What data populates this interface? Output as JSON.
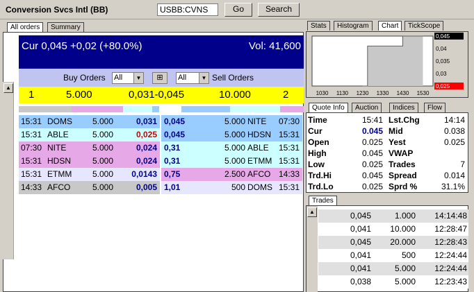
{
  "header": {
    "title": "Conversion Svcs Intl (BB)",
    "symbol": "USBB:CVNS",
    "go_label": "Go",
    "search_label": "Search"
  },
  "left_tabs": [
    "All orders",
    "Summary"
  ],
  "quote_bar": {
    "cur": "Cur 0,045 +0,02 (+80.0%)",
    "vol": "Vol: 41,600"
  },
  "orders_header": {
    "buy_label": "Buy Orders",
    "sell_label": "Sell Orders",
    "buy_filter": "All",
    "sell_filter": "All"
  },
  "best": {
    "bid_count": "1",
    "bid_size": "5.000",
    "spread": "0,031-0,045",
    "ask_size": "10.000",
    "ask_count": "2"
  },
  "colors": {
    "navy": "#00008b",
    "yellow": "#ffff00",
    "blue_row": "#99ccff",
    "cyan_row": "#ccffff",
    "pink_row": "#e6a8e6",
    "lavender_row": "#e6e6ff",
    "grey_row": "#c8c8c8",
    "red_price": "#cc0000"
  },
  "buy_orders": [
    {
      "time": "15:31",
      "mm": "DOMS",
      "size": "5.000",
      "price": "0,031",
      "color": "#99ccff",
      "price_color": "#00008b"
    },
    {
      "time": "15:31",
      "mm": "ABLE",
      "size": "5.000",
      "price": "0,025",
      "color": "#ccffff",
      "price_color": "#cc0000"
    },
    {
      "time": "07:30",
      "mm": "NITE",
      "size": "5.000",
      "price": "0,024",
      "color": "#e6a8e6",
      "price_color": "#00008b"
    },
    {
      "time": "15:31",
      "mm": "HDSN",
      "size": "5.000",
      "price": "0,024",
      "color": "#e6a8e6",
      "price_color": "#00008b"
    },
    {
      "time": "15:31",
      "mm": "ETMM",
      "size": "5.000",
      "price": "0,0143",
      "color": "#e6e6ff",
      "price_color": "#00008b"
    },
    {
      "time": "14:33",
      "mm": "AFCO",
      "size": "5.000",
      "price": "0,005",
      "color": "#c8c8c8",
      "price_color": "#00008b"
    }
  ],
  "sell_orders": [
    {
      "price": "0,045",
      "size": "5.000",
      "mm": "NITE",
      "time": "07:30",
      "color": "#99ccff"
    },
    {
      "price": "0,045",
      "size": "5.000",
      "mm": "HDSN",
      "time": "15:31",
      "color": "#99ccff"
    },
    {
      "price": "0,31",
      "size": "5.000",
      "mm": "ABLE",
      "time": "15:31",
      "color": "#ccffff"
    },
    {
      "price": "0,31",
      "size": "5.000",
      "mm": "ETMM",
      "time": "15:31",
      "color": "#ccffff"
    },
    {
      "price": "0,75",
      "size": "2.500",
      "mm": "AFCO",
      "time": "14:33",
      "color": "#e6a8e6"
    },
    {
      "price": "1,01",
      "size": "500",
      "mm": "DOMS",
      "time": "15:31",
      "color": "#e6e6ff"
    }
  ],
  "right_tabs_top": [
    "Stats",
    "Histogram",
    "Chart",
    "TickScope"
  ],
  "chart_data": {
    "type": "line",
    "x_ticks": [
      "1030",
      "1130",
      "1230",
      "1330",
      "1430",
      "1530"
    ],
    "y_ticks": [
      "0,045",
      "0,04",
      "0,035",
      "0,03",
      "0,025"
    ],
    "ylim": [
      0.025,
      0.045
    ],
    "series": [
      {
        "x": [
          "1230",
          "1245",
          "1245",
          "1430",
          "1430",
          "1530"
        ],
        "values": [
          0.025,
          0.025,
          0.041,
          0.041,
          0.045,
          0.045
        ]
      }
    ],
    "last_price_label": "0,045",
    "low_price_label": "0,025"
  },
  "quote_tabs": [
    "Quote Info",
    "Auction",
    "Indices",
    "Flow"
  ],
  "quote_info": [
    {
      "l": "Time",
      "lv": "15:41",
      "r": "Lst.Chg",
      "rv": "14:14"
    },
    {
      "l": "Cur",
      "lv": "0.045",
      "r": "Mid",
      "rv": "0.038"
    },
    {
      "l": "Open",
      "lv": "0.025",
      "r": "Yest",
      "rv": "0.025"
    },
    {
      "l": "High",
      "lv": "0.045",
      "r": "VWAP",
      "rv": ""
    },
    {
      "l": "Low",
      "lv": "0.025",
      "r": "Trades",
      "rv": "7"
    },
    {
      "l": "Trd.Hi",
      "lv": "0.045",
      "r": "Spread",
      "rv": "0.014"
    },
    {
      "l": "Trd.Lo",
      "lv": "0.025",
      "r": "Sprd %",
      "rv": "31.1%"
    }
  ],
  "trades_tab": "Trades",
  "trades": [
    {
      "price": "0,045",
      "size": "1.000",
      "time": "14:14:48"
    },
    {
      "price": "0,041",
      "size": "10.000",
      "time": "12:28:47"
    },
    {
      "price": "0,045",
      "size": "20.000",
      "time": "12:28:43"
    },
    {
      "price": "0,041",
      "size": "500",
      "time": "12:24:44"
    },
    {
      "price": "0,041",
      "size": "5.000",
      "time": "12:24:44"
    },
    {
      "price": "0,038",
      "size": "5.000",
      "time": "12:23:43"
    }
  ]
}
